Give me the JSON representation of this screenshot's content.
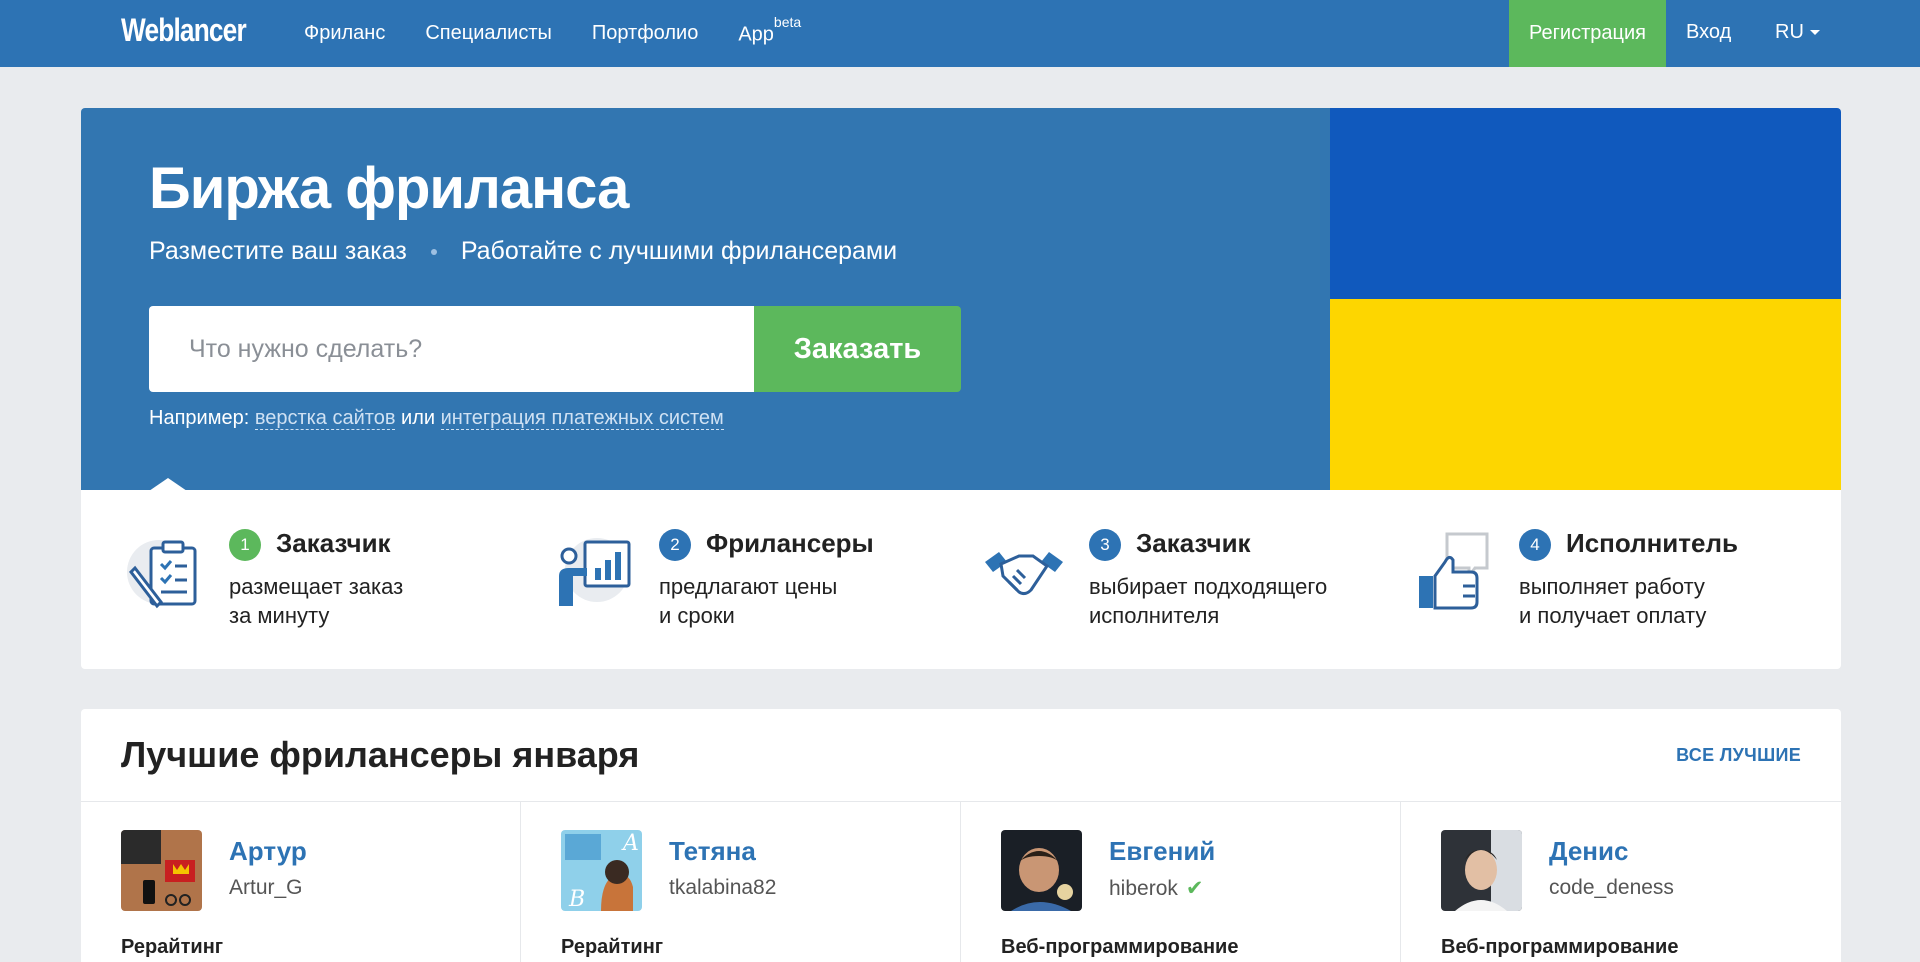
{
  "nav": {
    "logo": "Weblancer",
    "links": [
      "Фриланс",
      "Специалисты",
      "Портфолио",
      "App"
    ],
    "app_sup": "beta",
    "register": "Регистрация",
    "login": "Вход",
    "lang": "RU"
  },
  "hero": {
    "title": "Биржа фриланса",
    "subtitle_left": "Разместите ваш заказ",
    "subtitle_right": "Работайте с лучшими фрилансерами",
    "search_placeholder": "Что нужно сделать?",
    "order_button": "Заказать",
    "example_prefix": "Например:",
    "example_link1": "верстка сайтов",
    "example_or": "или",
    "example_link2": "интеграция платежных систем",
    "flag_colors": {
      "top": "#1059bd",
      "bottom": "#fdd600"
    }
  },
  "steps": [
    {
      "num": "1",
      "title": "Заказчик",
      "line1": "размещает заказ",
      "line2": "за минуту",
      "badge_color": "#5cb85c",
      "icon": "clipboard-icon"
    },
    {
      "num": "2",
      "title": "Фрилансеры",
      "line1": "предлагают цены",
      "line2": "и сроки",
      "badge_color": "#2d73b4",
      "icon": "presentation-icon"
    },
    {
      "num": "3",
      "title": "Заказчик",
      "line1": "выбирает подходящего",
      "line2": "исполнителя",
      "badge_color": "#2d73b4",
      "icon": "handshake-icon"
    },
    {
      "num": "4",
      "title": "Исполнитель",
      "line1": "выполняет работу",
      "line2": "и получает оплату",
      "badge_color": "#2d73b4",
      "icon": "thumbs-up-icon"
    }
  ],
  "best": {
    "title": "Лучшие фрилансеры января",
    "all_link": "ВСЕ ЛУЧШИЕ",
    "freelancers": [
      {
        "name": "Артур",
        "login": "Artur_G",
        "category": "Рерайтинг",
        "verified": false
      },
      {
        "name": "Тетяна",
        "login": "tkalabina82",
        "category": "Рерайтинг",
        "verified": false
      },
      {
        "name": "Евгений",
        "login": "hiberok",
        "category": "Веб-программирование",
        "verified": true
      },
      {
        "name": "Денис",
        "login": "code_deness",
        "category": "Веб-программирование",
        "verified": false
      }
    ]
  },
  "colors": {
    "nav_bg": "#2d73b4",
    "hero_bg": "#3276b1",
    "accent_green": "#5cb85c",
    "page_bg": "#e9ebee"
  }
}
